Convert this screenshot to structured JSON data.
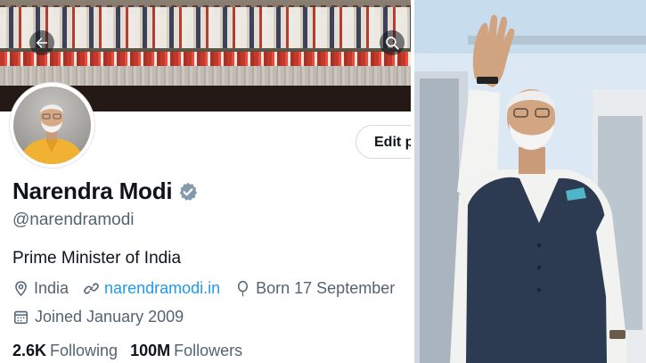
{
  "profile": {
    "name": "Narendra Modi",
    "handle": "@narendramodi",
    "bio": "Prime Minister of India",
    "location": "India",
    "website": "narendramodi.in",
    "born": "Born 17 September",
    "joined": "Joined January 2009",
    "following_count": "2.6K",
    "following_label": "Following",
    "followers_count": "100M",
    "followers_label": "Followers",
    "edit_label": "Edit p"
  },
  "colors": {
    "verified": "#829aab",
    "link": "#1d9bf0",
    "secondary_text": "#536471",
    "primary_text": "#0f1419",
    "vest": "#2c3a52",
    "kurta": "#f2f2f0"
  },
  "icons": {
    "back": "arrow-left-icon",
    "search": "search-icon",
    "verified": "verified-badge-icon",
    "location": "location-pin-icon",
    "link": "link-icon",
    "birthday": "balloon-icon",
    "calendar": "calendar-icon"
  }
}
